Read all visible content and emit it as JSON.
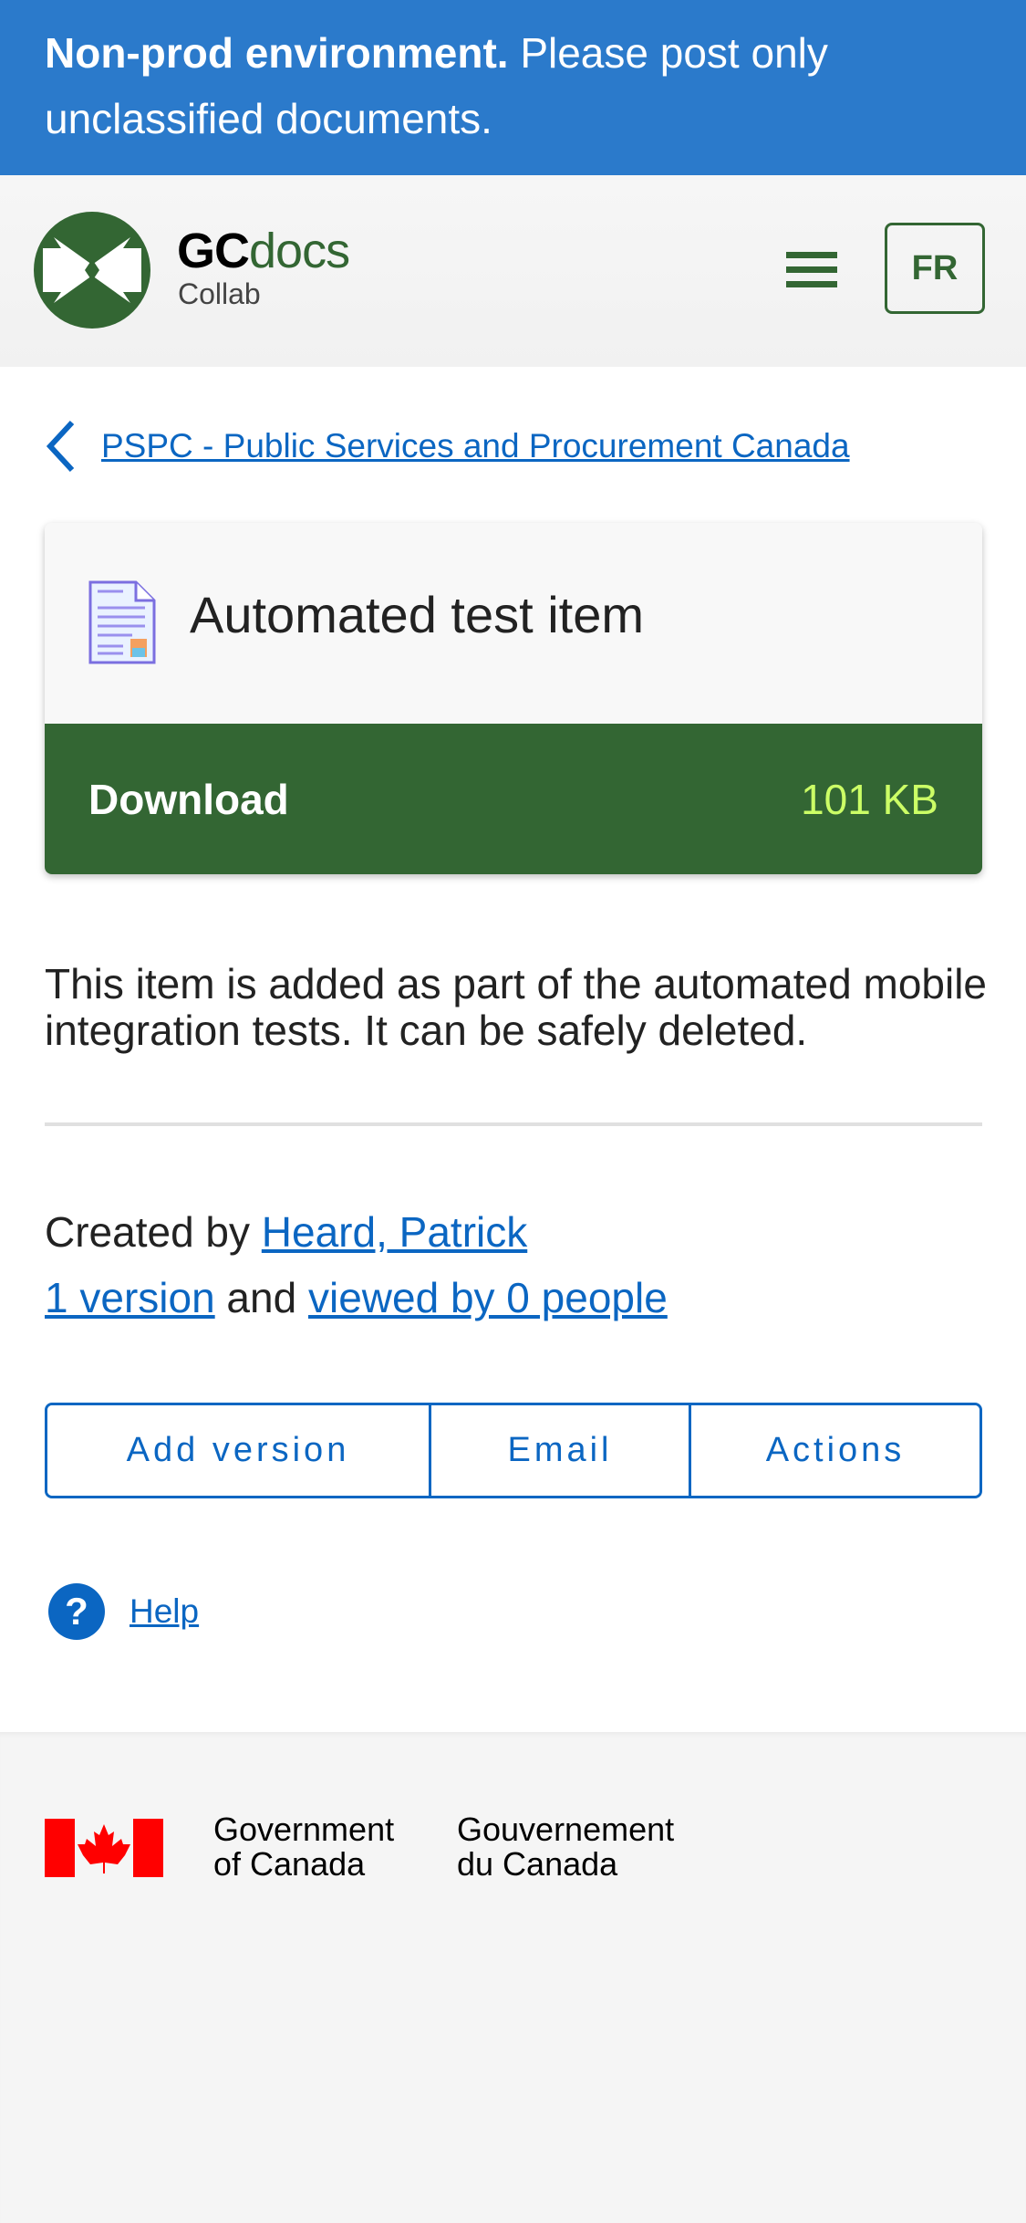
{
  "banner": {
    "bold": "Non-prod environment.",
    "text": " Please post only unclassified documents."
  },
  "header": {
    "brand_gc": "GC",
    "brand_docs": "docs",
    "brand_sub": "Collab",
    "lang_button": "FR"
  },
  "breadcrumb": {
    "label": "PSPC - Public Services and Procurement Canada"
  },
  "item": {
    "title": "Automated test item",
    "download_label": "Download",
    "size": "101 KB"
  },
  "description": "This item is added as part of the automated mobile integration tests. It can be safely deleted.",
  "meta": {
    "created_prefix": "Created by ",
    "author": "Heard, Patrick",
    "versions": "1 version",
    "and": " and ",
    "views": "viewed by 0 people"
  },
  "actions": {
    "add_version": "Add version",
    "email": "Email",
    "actions": "Actions"
  },
  "help": {
    "label": "Help"
  },
  "footer": {
    "en_line1": "Government",
    "en_line2": "of Canada",
    "fr_line1": "Gouvernement",
    "fr_line2": "du Canada"
  },
  "colors": {
    "banner": "#2b7acb",
    "brand_green": "#336633",
    "link": "#0b66c2",
    "size": "#ccff66"
  }
}
